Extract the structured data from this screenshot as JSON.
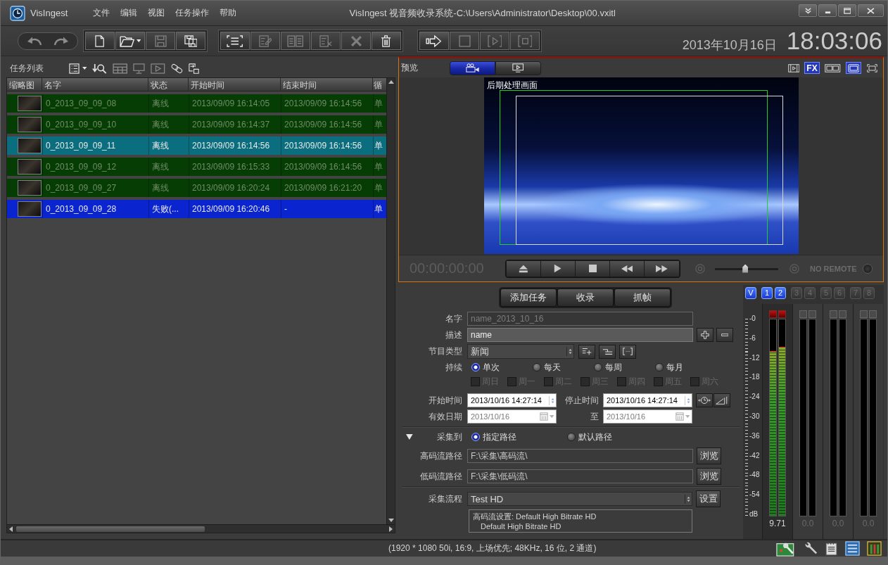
{
  "title_bar": {
    "app_name": "VisIngest",
    "menu": [
      "文件",
      "编辑",
      "视图",
      "任务操作",
      "帮助"
    ],
    "title": "VisIngest 视音频收录系统-C:\\Users\\Administrator\\Desktop\\00.vxitl"
  },
  "toolbar": {
    "groups": [
      [
        {
          "kind": "undo",
          "disabled": true
        },
        {
          "kind": "redo",
          "disabled": true
        }
      ],
      [
        {
          "kind": "new",
          "disabled": false
        },
        {
          "kind": "open",
          "disabled": false
        },
        {
          "kind": "save",
          "disabled": true
        },
        {
          "kind": "saveall",
          "disabled": false
        }
      ],
      [
        {
          "kind": "list",
          "disabled": false
        },
        {
          "kind": "edit",
          "disabled": true
        },
        {
          "kind": "columns",
          "disabled": true
        },
        {
          "kind": "removelist",
          "disabled": true
        },
        {
          "kind": "delete",
          "disabled": true
        },
        {
          "kind": "trash",
          "disabled": false
        }
      ],
      [
        {
          "kind": "forward",
          "disabled": false
        },
        {
          "kind": "stop",
          "disabled": true
        },
        {
          "kind": "step",
          "disabled": true
        },
        {
          "kind": "frame",
          "disabled": true
        }
      ]
    ],
    "date": "2013年10月16日",
    "time": "18:03:06"
  },
  "task_list": {
    "title": "任务列表",
    "tools": [
      {
        "kind": "listview",
        "disabled": false
      },
      {
        "kind": "import",
        "disabled": false
      },
      {
        "kind": "grid",
        "disabled": true
      },
      {
        "kind": "monitor",
        "disabled": true
      },
      {
        "kind": "playframe",
        "disabled": true
      },
      {
        "kind": "link",
        "disabled": false
      },
      {
        "kind": "export",
        "disabled": false
      }
    ],
    "columns": [
      "缩略图",
      "名字",
      "状态",
      "开始时间",
      "结束时间",
      "循"
    ],
    "rows": [
      {
        "name": "0_2013_09_09_08",
        "status": "离线",
        "start_time": "2013/09/09 16:14:05",
        "end_time": "2013/09/09 16:14:56",
        "column_6": "单",
        "color": "#053d05",
        "selected": false
      },
      {
        "name": "0_2013_09_09_10",
        "status": "离线",
        "start_time": "2013/09/09 16:14:37",
        "end_time": "2013/09/09 16:14:56",
        "column_6": "单",
        "color": "#053d05",
        "selected": false
      },
      {
        "name": "0_2013_09_09_11",
        "status": "离线",
        "start_time": "2013/09/09 16:14:56",
        "end_time": "2013/09/09 16:14:56",
        "column_6": "单",
        "color": "#0a6e7e",
        "selected": true
      },
      {
        "name": "0_2013_09_09_12",
        "status": "离线",
        "start_time": "2013/09/09 16:15:33",
        "end_time": "2013/09/09 16:14:56",
        "column_6": "单",
        "color": "#053d05",
        "selected": false
      },
      {
        "name": "0_2013_09_09_27",
        "status": "离线",
        "start_time": "2013/09/09 16:20:24",
        "end_time": "2013/09/09 16:21:20",
        "column_6": "单",
        "color": "#053d05",
        "selected": false
      },
      {
        "name": "0_2013_09_09_28",
        "status": "失败(...",
        "start_time": "2013/09/09 16:20:46",
        "end_time": "-",
        "column_6": "单",
        "color": "#0a24d0",
        "selected": true
      }
    ]
  },
  "preview": {
    "title": "预览",
    "tabs": [
      {
        "kind": "camera",
        "selected": true
      },
      {
        "kind": "screen",
        "selected": false
      }
    ],
    "toggles": [
      {
        "kind": "film",
        "on": false
      },
      {
        "kind": "fx",
        "label": "FX",
        "on": true
      },
      {
        "kind": "dual",
        "on": false
      },
      {
        "kind": "display",
        "on": true
      },
      {
        "kind": "fullscreen",
        "on": false
      }
    ],
    "overlay_label": "后期处理画面",
    "timecode": "00:00:00:00",
    "volume": {
      "level": 0.48
    },
    "remote_status": "NO REMOTE"
  },
  "task_form": {
    "actions": [
      "添加任务",
      "收录",
      "抓帧"
    ],
    "name": {
      "label": "名字",
      "placeholder": "name_2013_10_16"
    },
    "description": {
      "label": "描述",
      "value": "name"
    },
    "program_type": {
      "label": "节目类型",
      "value": "新闻"
    },
    "repeat": {
      "label": "持续",
      "options": [
        {
          "label": "单次",
          "selected": true
        },
        {
          "label": "每天",
          "selected": false
        },
        {
          "label": "每周",
          "selected": false
        },
        {
          "label": "每月",
          "selected": false
        }
      ]
    },
    "weekdays": [
      {
        "label": "周日",
        "checked": false,
        "disabled": true
      },
      {
        "label": "周一",
        "checked": false,
        "disabled": true
      },
      {
        "label": "周二",
        "checked": false,
        "disabled": true
      },
      {
        "label": "周三",
        "checked": false,
        "disabled": true
      },
      {
        "label": "周四",
        "checked": false,
        "disabled": true
      },
      {
        "label": "周五",
        "checked": false,
        "disabled": true
      },
      {
        "label": "周六",
        "checked": false,
        "disabled": true
      }
    ],
    "start_time": {
      "label": "开始时间",
      "value": "2013/10/16 14:27:14"
    },
    "stop_time": {
      "label": "停止时间",
      "value": "2013/10/16 14:27:14"
    },
    "valid_from": {
      "label": "有效日期",
      "value": "2013/10/16",
      "disabled": true
    },
    "valid_to": {
      "label": "至",
      "value": "2013/10/16",
      "disabled": true
    },
    "capture_to": {
      "label": "采集到",
      "expanded": true,
      "options": [
        {
          "label": "指定路径",
          "selected": true
        },
        {
          "label": "默认路径",
          "selected": false
        }
      ]
    },
    "high_bitrate_path": {
      "label": "高码流路径",
      "value": "F:\\采集\\高码流\\",
      "button": "浏览"
    },
    "low_bitrate_path": {
      "label": "低码流路径",
      "value": "F:\\采集\\低码流\\",
      "button": "浏览"
    },
    "workflow": {
      "label": "采集流程",
      "value": "Test HD",
      "button": "设置"
    },
    "workflow_details": [
      "高码流设置: Default High Bitrate HD",
      "Default High Bitrate HD"
    ]
  },
  "audio_meters": {
    "channels": [
      {
        "label": "V",
        "on": true
      },
      {
        "label": "1",
        "on": true
      },
      {
        "label": "2",
        "on": true
      },
      {
        "label": "3",
        "on": false
      },
      {
        "label": "4",
        "on": false
      },
      {
        "label": "5",
        "on": false
      },
      {
        "label": "6",
        "on": false
      },
      {
        "label": "7",
        "on": false
      },
      {
        "label": "8",
        "on": false
      }
    ],
    "scale": [
      "-0",
      "-6",
      "-12",
      "-18",
      "-24",
      "-30",
      "-36",
      "-42",
      "-48",
      "-54",
      "dB"
    ],
    "groups": [
      {
        "active": true,
        "reading": "9.71",
        "bars": [
          {
            "level": 0.84,
            "clipped": true
          },
          {
            "level": 0.86,
            "clipped": true
          }
        ]
      },
      {
        "active": false,
        "reading": "0.0",
        "bars": [
          {
            "clipped": false
          },
          {
            "clipped": false
          }
        ]
      },
      {
        "active": false,
        "reading": "0.0",
        "bars": [
          {
            "clipped": false
          },
          {
            "clipped": false
          }
        ]
      },
      {
        "active": false,
        "reading": "0.0",
        "bars": [
          {
            "clipped": false
          },
          {
            "clipped": false
          }
        ]
      }
    ]
  },
  "status_bar": {
    "text": "(1920 * 1080 50i, 16:9, 上场优先; 48KHz, 16 位, 2 通道)"
  }
}
